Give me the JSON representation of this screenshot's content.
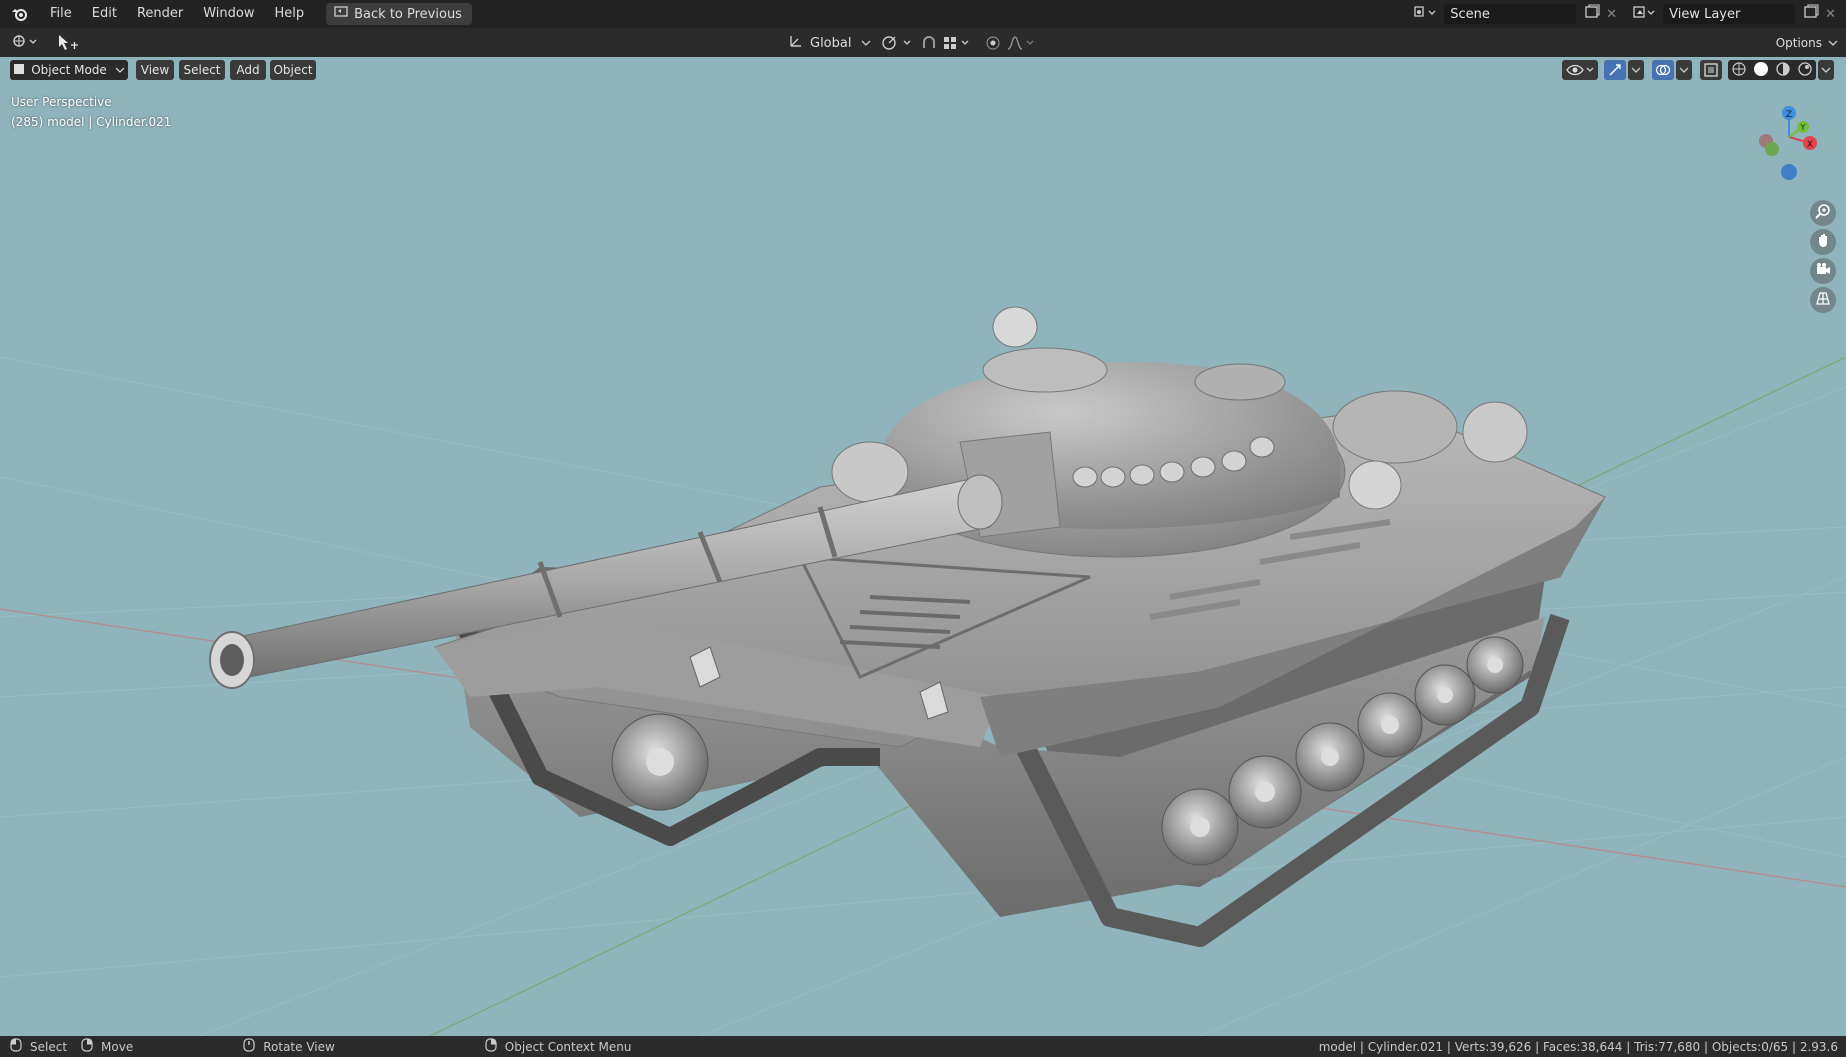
{
  "topbar": {
    "menus": [
      "File",
      "Edit",
      "Render",
      "Window",
      "Help"
    ],
    "back_label": "Back to Previous",
    "scene_name": "Scene",
    "view_layer_name": "View Layer"
  },
  "header": {
    "transform_orientation": "Global",
    "options_label": "Options"
  },
  "viewport_header": {
    "mode": "Object Mode",
    "menus": [
      "View",
      "Select",
      "Add",
      "Object"
    ]
  },
  "viewport": {
    "perspective_label": "User Perspective",
    "object_info": "(285) model | Cylinder.021",
    "gizmo_axes": {
      "x": "X",
      "y": "Y",
      "z": "Z"
    }
  },
  "statusbar": {
    "select": "Select",
    "move": "Move",
    "rotate": "Rotate View",
    "context_menu": "Object Context Menu",
    "stats": "model | Cylinder.021 | Verts:39,626 | Faces:38,644 | Tris:77,680 | Objects:0/65 | 2.93.6"
  },
  "colors": {
    "viewport_bg": "#8fb4bb",
    "x_axis": "#e0424e",
    "y_axis": "#6fbf3a",
    "z_axis": "#3f8fdc"
  }
}
